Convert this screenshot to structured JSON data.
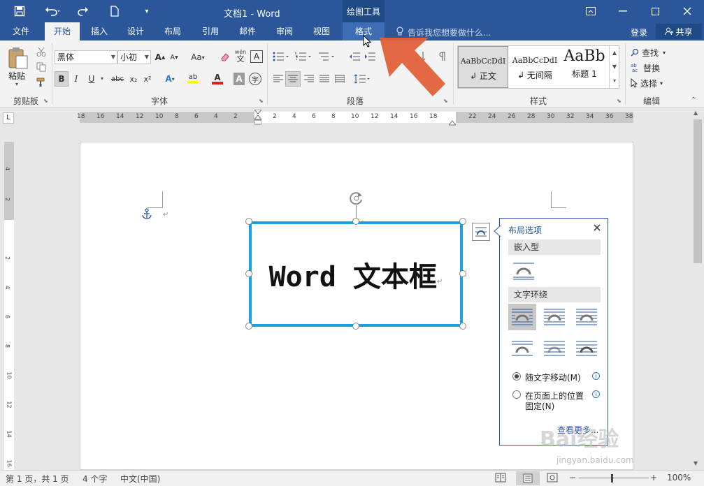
{
  "titlebar": {
    "document_title": "文档1 - Word",
    "context_tab_header": "绘图工具"
  },
  "tabs": [
    {
      "label": "文件"
    },
    {
      "label": "开始"
    },
    {
      "label": "插入"
    },
    {
      "label": "设计"
    },
    {
      "label": "布局"
    },
    {
      "label": "引用"
    },
    {
      "label": "邮件"
    },
    {
      "label": "审阅"
    },
    {
      "label": "视图"
    },
    {
      "label": "格式"
    }
  ],
  "tell_me": "告诉我您想要做什么...",
  "account": {
    "login": "登录",
    "share": "共享"
  },
  "ribbon": {
    "clipboard": {
      "paste": "粘贴",
      "label": "剪贴板"
    },
    "font": {
      "font_name": "黑体",
      "font_size": "小初",
      "label": "字体",
      "grow": "A",
      "shrink": "A",
      "case": "Aa",
      "phonetic_top": "wén",
      "phonetic_bottom": "文",
      "border_char": "A",
      "bold": "B",
      "italic": "I",
      "underline": "U",
      "strike": "abc",
      "subscript": "x₂",
      "superscript": "x²",
      "effects": "A",
      "highlight": "ab",
      "font_color": "A",
      "shading": "A",
      "enclose": "字"
    },
    "paragraph": {
      "label": "段落"
    },
    "styles": {
      "label": "样式",
      "items": [
        {
          "sample": "AaBbCcDdI",
          "name": "↲ 正文"
        },
        {
          "sample": "AaBbCcDdI",
          "name": "↲ 无间隔"
        },
        {
          "sample": "AaBb",
          "name": "标题 1"
        }
      ]
    },
    "editing": {
      "label": "编辑",
      "find": "查找",
      "replace": "替换",
      "select": "选择"
    }
  },
  "ruler": {
    "left_marks": [
      "18",
      "16",
      "14",
      "12",
      "10",
      "8",
      "6",
      "4",
      "2"
    ],
    "right_marks": [
      "2",
      "4",
      "6",
      "8",
      "10",
      "12",
      "14",
      "16",
      "18"
    ],
    "far_marks": [
      "22",
      "24",
      "26",
      "28",
      "30",
      "32",
      "34",
      "36",
      "38"
    ],
    "vertical_marks": [
      "4",
      "2",
      "2",
      "4",
      "6",
      "8",
      "10",
      "12",
      "14",
      "16"
    ]
  },
  "document": {
    "textbox_text": "Word 文本框",
    "paragraph_mark": "↵"
  },
  "layout_options": {
    "title": "布局选项",
    "inline_section": "嵌入型",
    "wrap_section": "文字环绕",
    "option_move": "随文字移动(M)",
    "option_fixed_line1": "在页面上的位置",
    "option_fixed_line2": "固定(N)",
    "see_more": "查看更多..."
  },
  "statusbar": {
    "page": "第 1 页，共 1 页",
    "words": "4 个字",
    "language": "中文(中国)",
    "zoom": "100%"
  },
  "watermark": {
    "text": "Bai经验",
    "url": "jingyan.baidu.com"
  },
  "colors": {
    "brand": "#2b579a",
    "textbox_border": "#1ba1e2",
    "arrow": "#e2603a"
  }
}
